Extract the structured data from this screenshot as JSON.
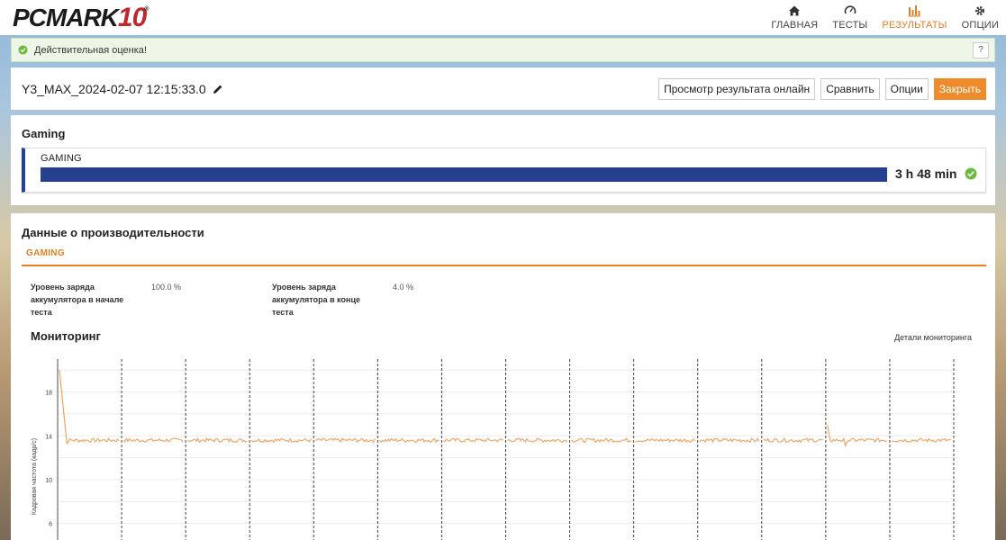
{
  "app": {
    "logo_text": "PCMARK",
    "logo_number": "10",
    "logo_reg": "®"
  },
  "nav": [
    {
      "label": "ГЛАВНАЯ",
      "icon": "home-icon",
      "active": false
    },
    {
      "label": "ТЕСТЫ",
      "icon": "gauge-icon",
      "active": false
    },
    {
      "label": "РЕЗУЛЬТАТЫ",
      "icon": "bar-chart-icon",
      "active": true
    },
    {
      "label": "ОПЦИИ",
      "icon": "gear-icon",
      "active": false
    }
  ],
  "banner": {
    "text": "Действительная оценка!",
    "help_label": "?"
  },
  "result": {
    "name": "Y3_MAX_2024-02-07 12:15:33.0",
    "buttons": {
      "view_online": "Просмотр результата онлайн",
      "compare": "Сравнить",
      "options": "Опции",
      "close": "Закрыть"
    }
  },
  "gaming": {
    "section_title": "Gaming",
    "label": "GAMING",
    "score": "3 h 48 min",
    "bar_fraction": 1.0
  },
  "performance": {
    "title": "Данные о производительности",
    "tab": "GAMING",
    "metrics": [
      {
        "label_lines": [
          "Уровень заряда",
          "аккумулятора в начале",
          "теста"
        ],
        "value": "100.0 %"
      },
      {
        "label_lines": [
          "Уровень заряда",
          "аккумулятора в конце",
          "теста"
        ],
        "value": "4.0 %"
      }
    ],
    "monitoring_title": "Мониторинг",
    "monitoring_details": "Детали мониторинга"
  },
  "chart_data": {
    "type": "line",
    "ylabel": "Кадровая частота (кадр/с)",
    "y_ticks": [
      6,
      10,
      14,
      18
    ],
    "ylim": [
      4.5,
      21
    ],
    "segments": 14,
    "series": [
      {
        "color": "#f0a566",
        "baseline": 13.6,
        "start_spike": [
          20.0,
          13.3
        ],
        "late_spike_segment": 13,
        "late_spike_value": 15.0
      }
    ]
  },
  "colors": {
    "accent": "#e67e22",
    "bar": "#263f8f",
    "ok": "#6dbb3e"
  }
}
